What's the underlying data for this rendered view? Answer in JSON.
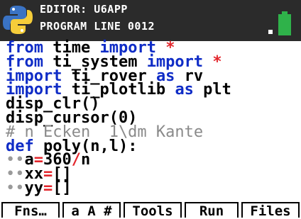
{
  "titlebar": {
    "line1": "EDITOR: U6APP",
    "line2": "PROGRAM LINE 0012"
  },
  "code": {
    "lines": [
      {
        "parts": [
          {
            "t": "from",
            "c": "kw"
          },
          {
            "t": " time ",
            "c": ""
          },
          {
            "t": "import",
            "c": "kw"
          },
          {
            "t": " *",
            "c": "red"
          }
        ]
      },
      {
        "parts": [
          {
            "t": "from",
            "c": "kw"
          },
          {
            "t": " ti_system ",
            "c": ""
          },
          {
            "t": "import",
            "c": "kw"
          },
          {
            "t": " *",
            "c": "red"
          }
        ]
      },
      {
        "parts": [
          {
            "t": "import",
            "c": "kw"
          },
          {
            "t": " ti_rover ",
            "c": ""
          },
          {
            "t": "as",
            "c": "kw"
          },
          {
            "t": " rv",
            "c": ""
          }
        ]
      },
      {
        "parts": [
          {
            "t": "import",
            "c": "kw"
          },
          {
            "t": " ti_plotlib ",
            "c": ""
          },
          {
            "t": "as",
            "c": "kw"
          },
          {
            "t": " plt",
            "c": ""
          }
        ]
      },
      {
        "parts": [
          {
            "t": "disp_clr()",
            "c": ""
          }
        ]
      },
      {
        "parts": [
          {
            "t": "disp_cursor(0)",
            "c": ""
          }
        ]
      },
      {
        "parts": [
          {
            "t": "# n Ecken  1\\dm Kante",
            "c": "cmt"
          }
        ]
      },
      {
        "parts": [
          {
            "t": "def",
            "c": "kw"
          },
          {
            "t": " poly(n,l):",
            "c": ""
          }
        ]
      },
      {
        "parts": [
          {
            "t": "••",
            "c": "dot"
          },
          {
            "t": "a",
            "c": ""
          },
          {
            "t": "=",
            "c": "red"
          },
          {
            "t": "360",
            "c": ""
          },
          {
            "t": "/",
            "c": "red"
          },
          {
            "t": "n",
            "c": ""
          }
        ]
      },
      {
        "parts": [
          {
            "t": "••",
            "c": "dot"
          },
          {
            "t": "xx",
            "c": ""
          },
          {
            "t": "=",
            "c": "red"
          },
          {
            "t": "[]",
            "c": ""
          }
        ]
      },
      {
        "parts": [
          {
            "t": "••",
            "c": "dot"
          },
          {
            "t": "yy",
            "c": ""
          },
          {
            "t": "=",
            "c": "red"
          },
          {
            "t": "[]",
            "c": ""
          }
        ]
      }
    ]
  },
  "softkeys": [
    "Fns…",
    "a A #",
    "Tools",
    "Run",
    "Files"
  ],
  "icons": {
    "logo": "python-logo-icon",
    "battery": "battery-icon"
  },
  "colors": {
    "keyword": "#0f2cc6",
    "operator": "#e3262c",
    "comment": "#8a8a8a",
    "titlebar_bg": "#2b2b2b",
    "battery": "#2fb24a"
  }
}
